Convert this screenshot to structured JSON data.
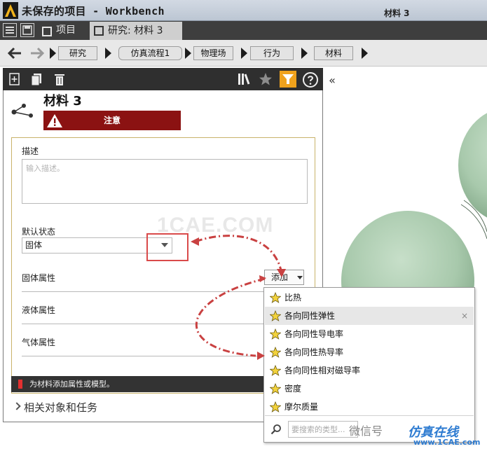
{
  "window": {
    "title": "未保存的项目 - Workbench"
  },
  "tabs": [
    {
      "label": "项目"
    },
    {
      "label": "研究: 材料 3"
    }
  ],
  "breadcrumb": {
    "items": [
      "研究",
      "仿真流程1",
      "物理场",
      "行为",
      "材料"
    ],
    "current": "材料 3"
  },
  "panel": {
    "title": "材料 3",
    "warning_label": "注意",
    "description": {
      "label": "描述",
      "placeholder": "输入描述。"
    },
    "default_state": {
      "label": "默认状态",
      "value": "固体"
    },
    "sections": {
      "solid": "固体属性",
      "liquid": "液体属性",
      "gas": "气体属性"
    },
    "add_button": "添加",
    "status_message": "为材料添加属性或模型。",
    "related_section": "相关对象和任务"
  },
  "add_menu": {
    "items": [
      "比热",
      "各向同性弹性",
      "各向同性导电率",
      "各向同性热导率",
      "各向同性相对磁导率",
      "密度",
      "摩尔质量"
    ],
    "selected_index": 1,
    "close_glyph": "×",
    "search_placeholder": "要搜索的类型..."
  },
  "watermarks": {
    "center": "1CAE.COM",
    "wechat": "微信号",
    "brand": "仿真在线",
    "url": "www.1CAE.com"
  },
  "colors": {
    "warning_bg": "#8b1212",
    "filter_active": "#f0a21c",
    "highlight": "#d94a4a",
    "model_green": "#a8c9ac"
  }
}
